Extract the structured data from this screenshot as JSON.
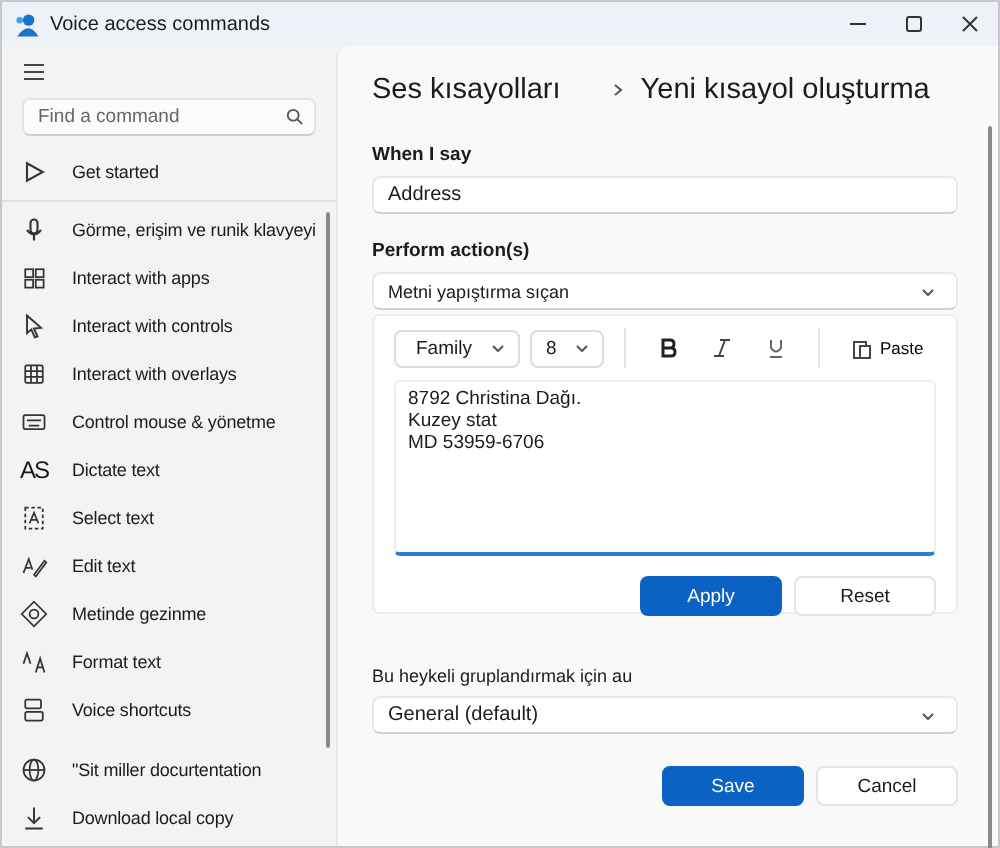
{
  "window": {
    "title": "Voice access commands"
  },
  "sidebar": {
    "search": {
      "placeholder": "Find a command"
    },
    "items": [
      {
        "label": "Get started",
        "selected": false
      },
      {
        "label": "Görme, erişim ve runik klavyeyi",
        "selected": false
      },
      {
        "label": "Interact with apps",
        "selected": false
      },
      {
        "label": "Interact with controls",
        "selected": false
      },
      {
        "label": "Interact with overlays",
        "selected": false
      },
      {
        "label": "Control mouse & yönetme",
        "selected": false
      },
      {
        "label": "Dictate text",
        "glyph": "AS",
        "selected": false
      },
      {
        "label": "Select text",
        "selected": false
      },
      {
        "label": "Edit text",
        "selected": false
      },
      {
        "label": "Metinde gezinme",
        "selected": false
      },
      {
        "label": "Format text",
        "selected": false
      },
      {
        "label": "Voice shortcuts",
        "selected": false
      }
    ],
    "footer": [
      {
        "label": "\"Sit miller docurtentation"
      },
      {
        "label": "Download local copy"
      }
    ]
  },
  "main": {
    "breadcrumb": [
      "Ses kısayolları",
      "Yeni kısayol oluşturma"
    ],
    "when_i_say": {
      "label": "When I say",
      "value": "Address"
    },
    "perform": {
      "label": "Perform action(s)",
      "value": "Metni yapıştırma sıçan"
    },
    "editor": {
      "font": "Family",
      "size": "8",
      "paste": "Paste",
      "lines": [
        "8792 Christina Dağı.",
        "Kuzey stat",
        "MD 53959-6706"
      ],
      "apply": "Apply",
      "reset": "Reset"
    },
    "group": {
      "label": "Bu heykeli gruplandırmak için au",
      "value": "General (default)"
    },
    "save": "Save",
    "cancel": "Cancel"
  }
}
